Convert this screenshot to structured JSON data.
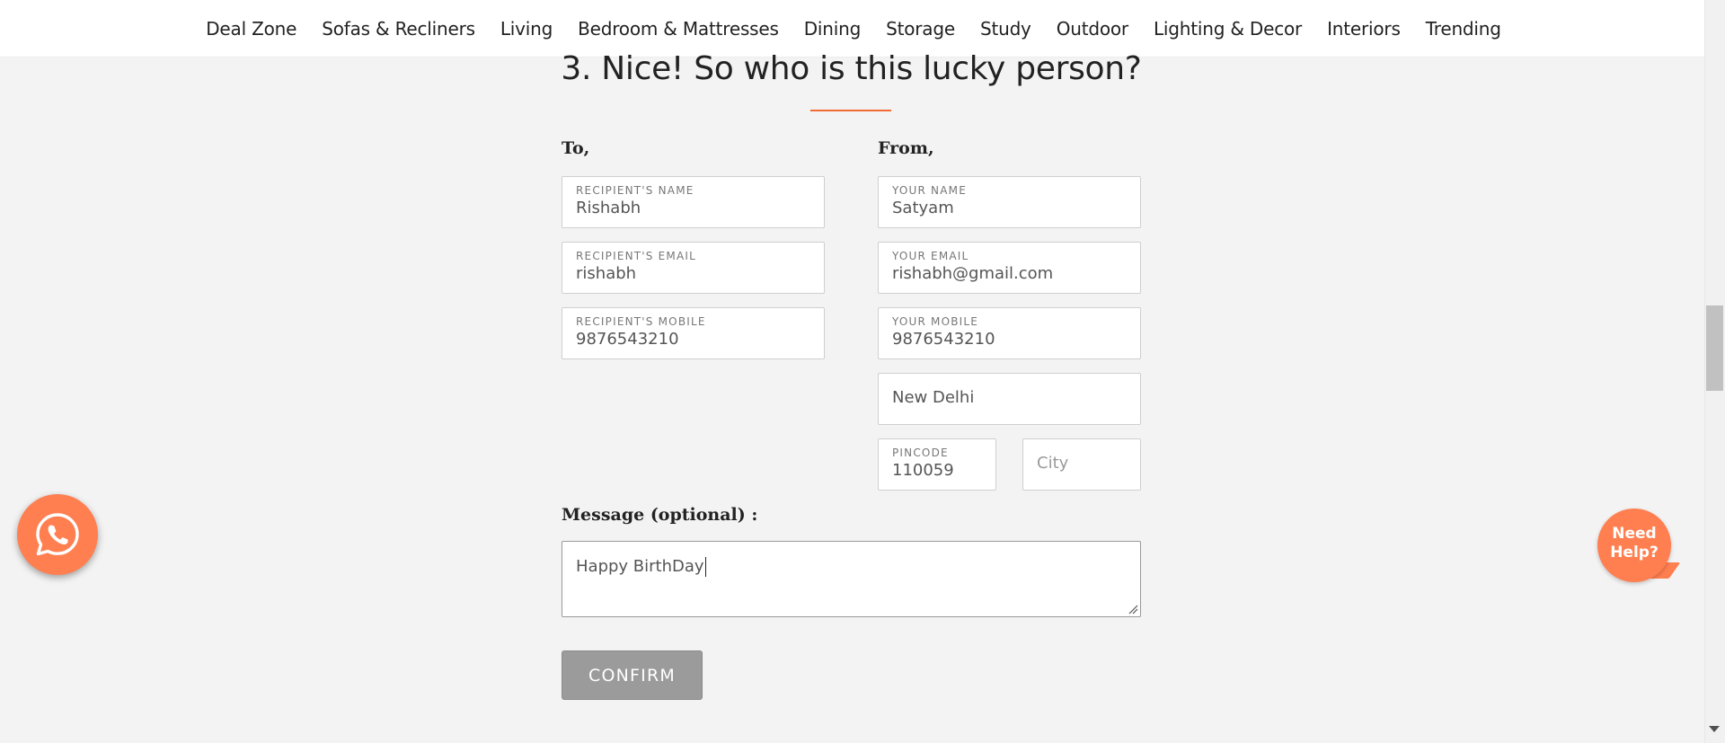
{
  "nav": {
    "items": [
      {
        "label": "Deal Zone"
      },
      {
        "label": "Sofas & Recliners"
      },
      {
        "label": "Living"
      },
      {
        "label": "Bedroom & Mattresses"
      },
      {
        "label": "Dining"
      },
      {
        "label": "Storage"
      },
      {
        "label": "Study"
      },
      {
        "label": "Outdoor"
      },
      {
        "label": "Lighting & Decor"
      },
      {
        "label": "Interiors"
      },
      {
        "label": "Trending"
      }
    ]
  },
  "section": {
    "title": "3. Nice! So who is this lucky person?"
  },
  "to": {
    "heading": "To,",
    "name": {
      "label": "RECIPIENT'S NAME",
      "value": "Rishabh"
    },
    "email": {
      "label": "RECIPIENT'S EMAIL",
      "value": "rishabh"
    },
    "mobile": {
      "label": "RECIPIENT'S MOBILE",
      "value": "9876543210"
    }
  },
  "from": {
    "heading": "From,",
    "name": {
      "label": "YOUR NAME",
      "value": "Satyam"
    },
    "email": {
      "label": "YOUR EMAIL",
      "value": "rishabh@gmail.com"
    },
    "mobile": {
      "label": "YOUR MOBILE",
      "value": "9876543210"
    },
    "address": {
      "value": "New Delhi"
    },
    "pincode": {
      "label": "PINCODE",
      "value": "110059"
    },
    "city": {
      "placeholder": "City"
    }
  },
  "message": {
    "label": "Message (optional) :",
    "value": "Happy BirthDay"
  },
  "confirm_label": "CONFIRM",
  "help": {
    "line1": "Need",
    "line2": "Help?"
  },
  "icons": {
    "whatsapp": "whatsapp-icon",
    "resize": "resize-handle-icon"
  },
  "colors": {
    "accent": "#ff7f50",
    "underline": "#f26a35",
    "button": "#9b9b9b"
  }
}
